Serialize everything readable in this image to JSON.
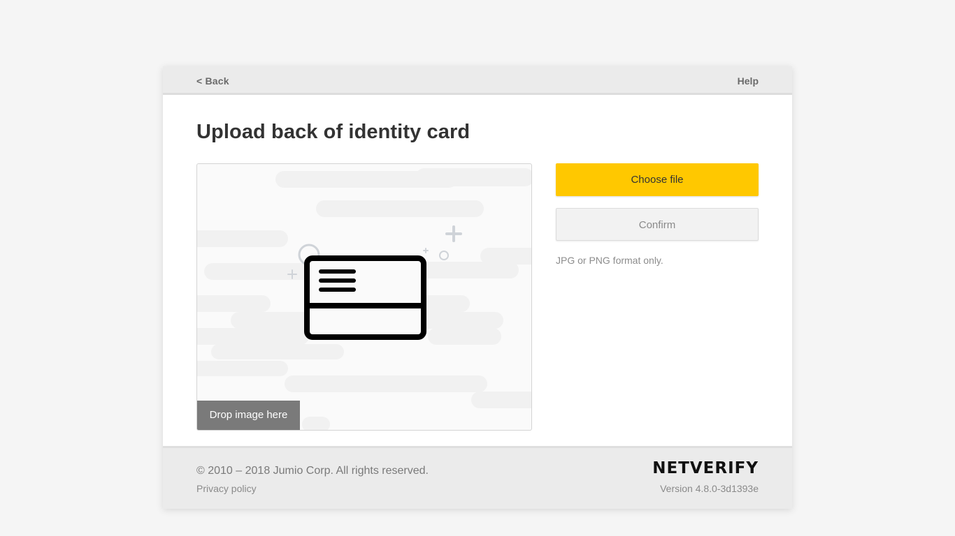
{
  "topbar": {
    "back_label": "< Back",
    "help_label": "Help"
  },
  "main": {
    "title": "Upload back of identity card",
    "dropzone_label": "Drop image here",
    "dropzone_icon": "id-card-back-icon"
  },
  "actions": {
    "choose_file_label": "Choose file",
    "confirm_label": "Confirm",
    "format_note": "JPG or PNG format only."
  },
  "footer": {
    "copyright": "© 2010 – 2018 Jumio Corp. All rights reserved.",
    "privacy_label": "Privacy policy",
    "brand": "NETVERIFY",
    "version": "Version 4.8.0-3d1393e"
  },
  "colors": {
    "accent": "#ffc800",
    "page_background": "#f5f5f5",
    "bar_background": "#ebebeb"
  }
}
